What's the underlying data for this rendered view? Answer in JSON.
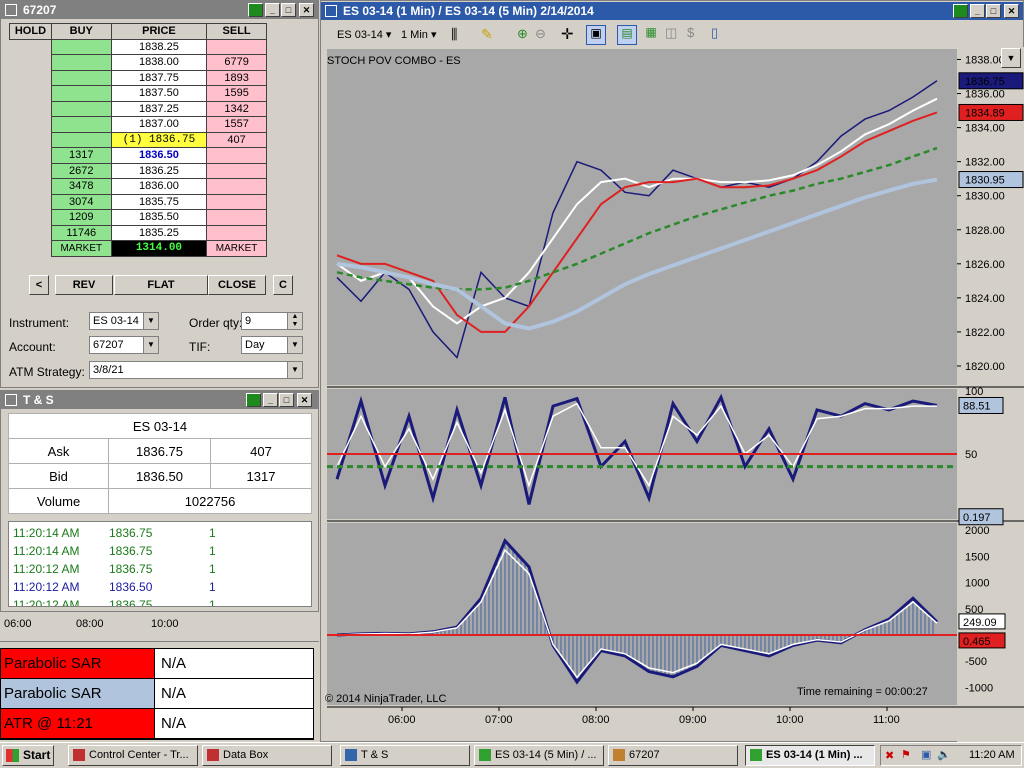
{
  "dom_window": {
    "title": "67207"
  },
  "dom": {
    "headers": {
      "hold": "HOLD",
      "buy": "BUY",
      "price": "PRICE",
      "sell": "SELL"
    },
    "rows": [
      {
        "buy": "",
        "price": "1838.25",
        "sell": ""
      },
      {
        "buy": "",
        "price": "1838.00",
        "sell": "6779"
      },
      {
        "buy": "",
        "price": "1837.75",
        "sell": "1893"
      },
      {
        "buy": "",
        "price": "1837.50",
        "sell": "1595"
      },
      {
        "buy": "",
        "price": "1837.25",
        "sell": "1342"
      },
      {
        "buy": "",
        "price": "1837.00",
        "sell": "1557"
      },
      {
        "buy": "",
        "price": "(1) 1836.75",
        "sell": "407"
      },
      {
        "buy": "1317",
        "price": "1836.50",
        "sell": ""
      },
      {
        "buy": "2672",
        "price": "1836.25",
        "sell": ""
      },
      {
        "buy": "3478",
        "price": "1836.00",
        "sell": ""
      },
      {
        "buy": "3074",
        "price": "1835.75",
        "sell": ""
      },
      {
        "buy": "1209",
        "price": "1835.50",
        "sell": ""
      },
      {
        "buy": "11746",
        "price": "1835.25",
        "sell": ""
      }
    ],
    "market_row": {
      "buy": "MARKET",
      "price": "1314.00",
      "sell": "MARKET"
    },
    "buttons": {
      "left": "<",
      "rev": "REV",
      "flat": "FLAT",
      "close": "CLOSE",
      "c": "C"
    },
    "instrument_label": "Instrument:",
    "instrument_value": "ES 03-14",
    "order_qty_label": "Order qty:",
    "order_qty_value": "9",
    "account_label": "Account:",
    "account_value": "67207",
    "tif_label": "TIF:",
    "tif_value": "Day",
    "atm_label": "ATM Strategy:",
    "atm_value": "3/8/21"
  },
  "ts_window": {
    "title": "T & S"
  },
  "ts": {
    "instrument": "ES 03-14",
    "ask_label": "Ask",
    "ask_price": "1836.75",
    "ask_size": "407",
    "bid_label": "Bid",
    "bid_price": "1836.50",
    "bid_size": "1317",
    "volume_label": "Volume",
    "volume_value": "1022756",
    "tape": [
      {
        "time": "11:20:14 AM",
        "price": "1836.75",
        "size": "1",
        "color": "#1a7a1a"
      },
      {
        "time": "11:20:14 AM",
        "price": "1836.75",
        "size": "1",
        "color": "#1a7a1a"
      },
      {
        "time": "11:20:12 AM",
        "price": "1836.75",
        "size": "1",
        "color": "#1a7a1a"
      },
      {
        "time": "11:20:12 AM",
        "price": "1836.50",
        "size": "1",
        "color": "#1a1aa0"
      },
      {
        "time": "11:20:12 AM",
        "price": "1836.75",
        "size": "1",
        "color": "#1a7a1a"
      }
    ]
  },
  "databox": {
    "time_ticks": [
      "06:00",
      "08:00",
      "10:00"
    ],
    "rows": [
      {
        "label": "Parabolic SAR",
        "value": "N/A",
        "color": "#ff0000"
      },
      {
        "label": "Parabolic SAR",
        "value": "N/A",
        "color": "#b0c4de"
      },
      {
        "label": "ATR @ 11:21",
        "value": "N/A",
        "color": "#ff0000"
      }
    ]
  },
  "chart_window": {
    "title": "ES 03-14 (1 Min) / ES 03-14 (5 Min)  2/14/2014"
  },
  "chart_toolbar": {
    "instrument": "ES 03-14",
    "interval": "1 Min"
  },
  "chart": {
    "label": "STOCH POV COMBO - ES",
    "copyright": "© 2014 NinjaTrader, LLC",
    "time_remaining": "Time remaining = 00:00:27",
    "price_ticks": [
      "1838.00",
      "1836.00",
      "1834.00",
      "1832.00",
      "1830.00",
      "1828.00",
      "1826.00",
      "1824.00",
      "1822.00",
      "1820.00"
    ],
    "price_markers": [
      {
        "value": "1836.75",
        "color": "#1a1a7a"
      },
      {
        "value": "1834.89",
        "color": "#e02020"
      },
      {
        "value": "1830.95",
        "color": "#b0c4de"
      }
    ],
    "stoch_ticks": [
      "100",
      "50"
    ],
    "stoch_markers": [
      {
        "value": "88.51",
        "color": "#b0c4de"
      },
      {
        "value": "0.197",
        "color": "#b0c4de"
      }
    ],
    "osc_ticks": [
      "2000",
      "1500",
      "1000",
      "500",
      "-500",
      "-1000"
    ],
    "osc_markers": [
      {
        "value": "249.09",
        "color": "#ffffff"
      },
      {
        "value": "0.465",
        "color": "#e02020"
      }
    ],
    "time_ticks": [
      "06:00",
      "07:00",
      "08:00",
      "09:00",
      "10:00",
      "11:00"
    ]
  },
  "chart_data": [
    {
      "type": "line",
      "title": "STOCH POV COMBO - ES",
      "x": [
        "05:35",
        "05:50",
        "06:05",
        "06:20",
        "06:35",
        "06:45",
        "06:55",
        "07:05",
        "07:15",
        "07:25",
        "07:35",
        "07:50",
        "08:05",
        "08:20",
        "08:35",
        "08:50",
        "09:05",
        "09:20",
        "09:35",
        "09:50",
        "10:05",
        "10:20",
        "10:35",
        "10:50",
        "11:05",
        "11:20"
      ],
      "ylim": [
        1819,
        1838.5
      ],
      "series": [
        {
          "values": [
            1825.2,
            1823.8,
            1825.5,
            1824.5,
            1822,
            1820.5,
            1825.5,
            1824,
            1823.5,
            1829,
            1832,
            1831.5,
            1830.2,
            1830,
            1831.5,
            1831,
            1830.5,
            1830.8,
            1830.5,
            1831,
            1832,
            1833.5,
            1834.5,
            1835,
            1835.8,
            1836.75
          ]
        },
        {
          "values": [
            1826,
            1825,
            1825.5,
            1825.2,
            1823.5,
            1822.5,
            1823.5,
            1824,
            1825.5,
            1827.5,
            1829.5,
            1830.8,
            1831,
            1830.5,
            1831,
            1831,
            1830.8,
            1830.8,
            1830.9,
            1831.2,
            1831.8,
            1832.6,
            1833.6,
            1834.2,
            1835,
            1835.7
          ]
        },
        {
          "values": [
            1826.5,
            1826,
            1826,
            1825.5,
            1825,
            1823,
            1822,
            1822,
            1823.5,
            1825.5,
            1827.5,
            1829.5,
            1830.5,
            1830.8,
            1830.8,
            1831,
            1830.5,
            1830.5,
            1830.6,
            1831,
            1831.5,
            1832.3,
            1833.2,
            1833.8,
            1834.4,
            1834.89
          ]
        },
        {
          "values": [
            1825.5,
            1825.2,
            1825,
            1824.8,
            1824.6,
            1824.5,
            1824.5,
            1824.6,
            1825,
            1825.5,
            1826,
            1826.6,
            1827.2,
            1827.8,
            1828.3,
            1828.8,
            1829.2,
            1829.6,
            1830,
            1830.3,
            1830.7,
            1831,
            1831.4,
            1831.8,
            1832.3,
            1832.8
          ]
        },
        {
          "values": [
            1826,
            1825.8,
            1825.5,
            1825.2,
            1824.8,
            1824.5,
            1823.5,
            1822.5,
            1822.2,
            1822.6,
            1823.2,
            1824,
            1824.8,
            1825.4,
            1825.9,
            1826.4,
            1826.9,
            1827.4,
            1827.9,
            1828.4,
            1828.9,
            1829.4,
            1829.9,
            1830.3,
            1830.7,
            1830.95
          ]
        }
      ]
    },
    {
      "type": "line",
      "x": [
        "05:35",
        "05:50",
        "06:05",
        "06:20",
        "06:35",
        "06:45",
        "06:55",
        "07:05",
        "07:15",
        "07:25",
        "07:35",
        "07:50",
        "08:05",
        "08:20",
        "08:35",
        "08:50",
        "09:05",
        "09:20",
        "09:35",
        "09:50",
        "10:05",
        "10:20",
        "10:35",
        "10:50",
        "11:05",
        "11:20"
      ],
      "ylim": [
        0,
        100
      ],
      "series": [
        {
          "values": [
            30,
            92,
            25,
            80,
            15,
            85,
            25,
            95,
            10,
            88,
            94,
            40,
            60,
            15,
            90,
            60,
            95,
            40,
            70,
            30,
            85,
            80,
            90,
            85,
            92,
            88.51
          ]
        },
        {
          "values": [
            40,
            80,
            40,
            70,
            30,
            75,
            35,
            85,
            25,
            80,
            90,
            55,
            55,
            25,
            80,
            65,
            88,
            50,
            65,
            40,
            78,
            80,
            86,
            86,
            88,
            88
          ]
        }
      ]
    },
    {
      "type": "line",
      "x": [
        "05:35",
        "05:50",
        "06:05",
        "06:20",
        "06:35",
        "06:45",
        "06:55",
        "07:05",
        "07:15",
        "07:25",
        "07:35",
        "07:50",
        "08:05",
        "08:20",
        "08:35",
        "08:50",
        "09:05",
        "09:20",
        "09:35",
        "09:50",
        "10:05",
        "10:20",
        "10:35",
        "10:50",
        "11:05",
        "11:20"
      ],
      "ylim": [
        -1300,
        2100
      ],
      "series": [
        {
          "values": [
            0,
            20,
            30,
            20,
            60,
            150,
            700,
            1800,
            1300,
            -200,
            -900,
            -300,
            -400,
            -700,
            -800,
            -600,
            -200,
            -300,
            -400,
            -200,
            -100,
            -150,
            100,
            300,
            700,
            249.09
          ]
        }
      ]
    }
  ],
  "taskbar": {
    "start": "Start",
    "items": [
      "Control Center - Tr...",
      "Data Box",
      "T & S",
      "ES 03-14 (5 Min) / ...",
      "67207",
      "ES 03-14 (1 Min) ..."
    ],
    "clock": "11:20 AM"
  }
}
